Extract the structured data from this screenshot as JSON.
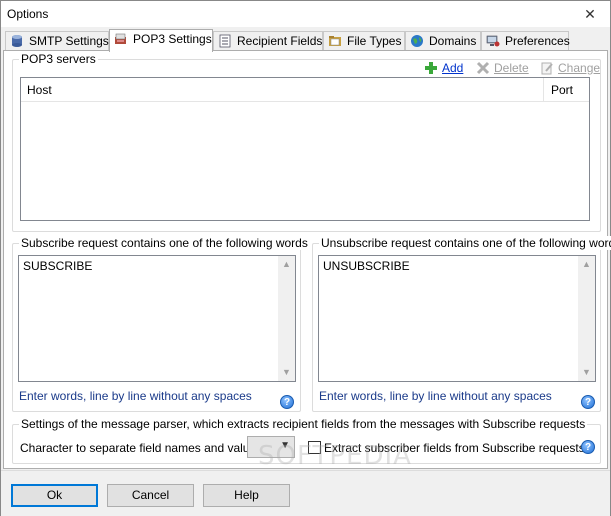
{
  "window": {
    "title": "Options",
    "close_glyph": "✕"
  },
  "tabs": [
    {
      "label": "SMTP Settings",
      "icon": "database-icon",
      "active": false
    },
    {
      "label": "POP3 Settings",
      "icon": "mail-server-icon",
      "active": true
    },
    {
      "label": "Recipient Fields",
      "icon": "list-document-icon",
      "active": false
    },
    {
      "label": "File Types",
      "icon": "folder-icon",
      "active": false
    },
    {
      "label": "Domains",
      "icon": "globe-icon",
      "active": false
    },
    {
      "label": "Preferences",
      "icon": "computer-settings-icon",
      "active": false
    }
  ],
  "pop3": {
    "group_label": "POP3 servers",
    "add_label": "Add",
    "delete_label": "Delete",
    "change_label": "Change",
    "columns": [
      "Host",
      "Port"
    ],
    "rows": []
  },
  "subscribe": {
    "group_label": "Subscribe request contains one of the following words",
    "value": "SUBSCRIBE",
    "hint": "Enter words, line by line without any spaces"
  },
  "unsubscribe": {
    "group_label": "Unsubscribe request contains one of the following words",
    "value": "UNSUBSCRIBE",
    "hint": "Enter words, line by line without any spaces"
  },
  "parser": {
    "group_label": "Settings of the message parser, which extracts recipient fields from the messages with Subscribe requests",
    "separator_label": "Character to separate field names and values :",
    "separator_value": "",
    "extract_label": "Extract subscriber fields from Subscribe requests",
    "extract_checked": false
  },
  "buttons": {
    "ok": "Ok",
    "cancel": "Cancel",
    "help": "Help"
  },
  "help_glyph": "?",
  "watermark": "SOFTPEDIA",
  "colors": {
    "link": "#0033cc",
    "disabled": "#a0a0a0",
    "hint": "#1a3a8a",
    "default_button_border": "#0078d7"
  }
}
